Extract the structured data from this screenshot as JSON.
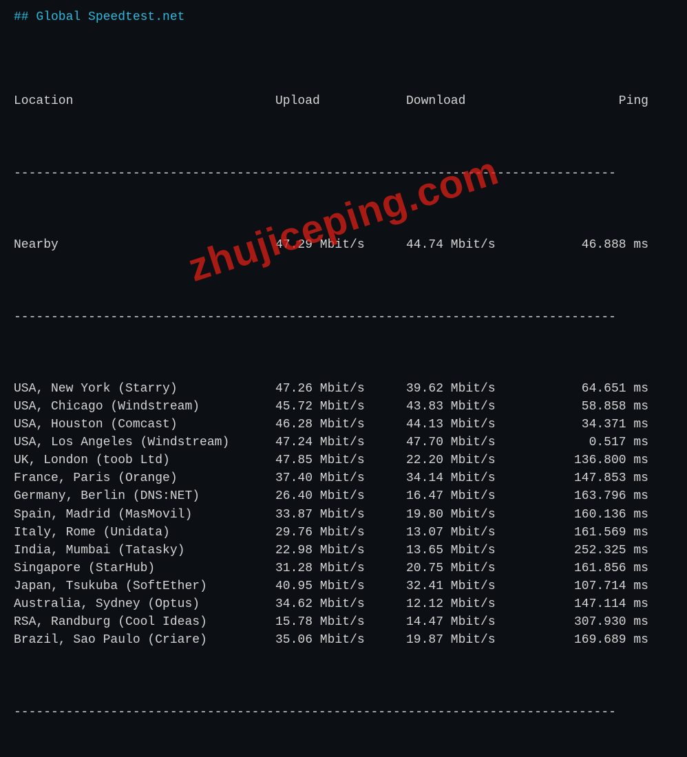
{
  "title": "## Global Speedtest.net",
  "separator": "---------------------------------------------------------------------------------",
  "headers": {
    "location": "Location",
    "upload": "Upload",
    "download": "Download",
    "ping": "Ping"
  },
  "nearby": {
    "location": "Nearby",
    "upload": "47.29 Mbit/s",
    "download": "44.74 Mbit/s",
    "ping": "46.888 ms"
  },
  "rows": [
    {
      "location": "USA, New York (Starry)",
      "upload": "47.26 Mbit/s",
      "download": "39.62 Mbit/s",
      "ping": "64.651 ms"
    },
    {
      "location": "USA, Chicago (Windstream)",
      "upload": "45.72 Mbit/s",
      "download": "43.83 Mbit/s",
      "ping": "58.858 ms"
    },
    {
      "location": "USA, Houston (Comcast)",
      "upload": "46.28 Mbit/s",
      "download": "44.13 Mbit/s",
      "ping": "34.371 ms"
    },
    {
      "location": "USA, Los Angeles (Windstream)",
      "upload": "47.24 Mbit/s",
      "download": "47.70 Mbit/s",
      "ping": "0.517 ms"
    },
    {
      "location": "UK, London (toob Ltd)",
      "upload": "47.85 Mbit/s",
      "download": "22.20 Mbit/s",
      "ping": "136.800 ms"
    },
    {
      "location": "France, Paris (Orange)",
      "upload": "37.40 Mbit/s",
      "download": "34.14 Mbit/s",
      "ping": "147.853 ms"
    },
    {
      "location": "Germany, Berlin (DNS:NET)",
      "upload": "26.40 Mbit/s",
      "download": "16.47 Mbit/s",
      "ping": "163.796 ms"
    },
    {
      "location": "Spain, Madrid (MasMovil)",
      "upload": "33.87 Mbit/s",
      "download": "19.80 Mbit/s",
      "ping": "160.136 ms"
    },
    {
      "location": "Italy, Rome (Unidata)",
      "upload": "29.76 Mbit/s",
      "download": "13.07 Mbit/s",
      "ping": "161.569 ms"
    },
    {
      "location": "India, Mumbai (Tatasky)",
      "upload": "22.98 Mbit/s",
      "download": "13.65 Mbit/s",
      "ping": "252.325 ms"
    },
    {
      "location": "Singapore (StarHub)",
      "upload": "31.28 Mbit/s",
      "download": "20.75 Mbit/s",
      "ping": "161.856 ms"
    },
    {
      "location": "Japan, Tsukuba (SoftEther)",
      "upload": "40.95 Mbit/s",
      "download": "32.41 Mbit/s",
      "ping": "107.714 ms"
    },
    {
      "location": "Australia, Sydney (Optus)",
      "upload": "34.62 Mbit/s",
      "download": "12.12 Mbit/s",
      "ping": "147.114 ms"
    },
    {
      "location": "RSA, Randburg (Cool Ideas)",
      "upload": "15.78 Mbit/s",
      "download": "14.47 Mbit/s",
      "ping": "307.930 ms"
    },
    {
      "location": "Brazil, Sao Paulo (Criare)",
      "upload": "35.06 Mbit/s",
      "download": "19.87 Mbit/s",
      "ping": "169.689 ms"
    }
  ],
  "watermark": "zhujiceping.com"
}
